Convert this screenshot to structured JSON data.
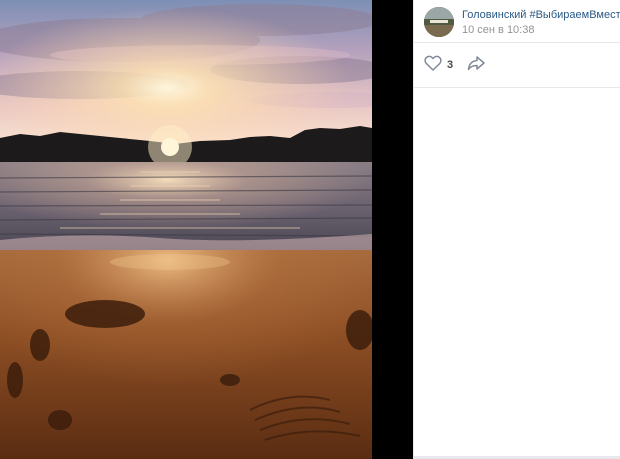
{
  "post": {
    "author": "Головинский #ВыбираемВместе",
    "date": "10 сен в 10:38",
    "likes": "3"
  },
  "icons": {
    "like": "heart-outline-icon",
    "share": "share-arrow-icon"
  },
  "colors": {
    "link": "#2a5885",
    "muted": "#939393",
    "divider": "#e7e8ec"
  }
}
